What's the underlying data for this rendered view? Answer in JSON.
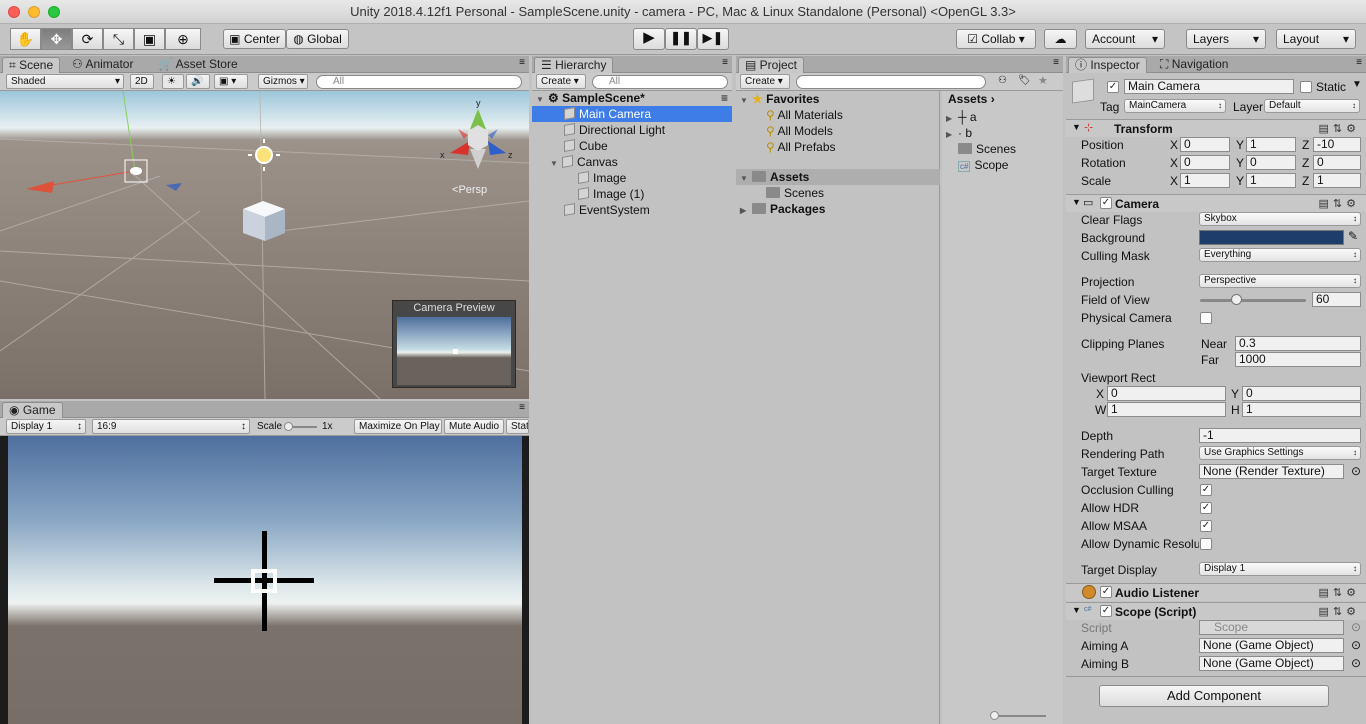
{
  "window": {
    "title": "Unity 2018.4.12f1 Personal - SampleScene.unity - camera - PC, Mac & Linux Standalone (Personal) <OpenGL 3.3>"
  },
  "toolbar": {
    "center": "Center",
    "global": "Global",
    "collab": "Collab",
    "account": "Account",
    "layers": "Layers",
    "layout": "Layout"
  },
  "scene": {
    "tabs": [
      "Scene",
      "Animator",
      "Asset Store"
    ],
    "shaded": "Shaded",
    "mode2d": "2D",
    "gizmos": "Gizmos",
    "search_placeholder": "All",
    "persp": "Persp",
    "camera_preview": "Camera Preview"
  },
  "game": {
    "tab": "Game",
    "display": "Display 1",
    "aspect": "16:9",
    "scale_label": "Scale",
    "scale_value": "1x",
    "maximize": "Maximize On Play",
    "mute": "Mute Audio",
    "stats": "Stats"
  },
  "hierarchy": {
    "tab": "Hierarchy",
    "create": "Create",
    "search_placeholder": "All",
    "scene": "SampleScene*",
    "items": [
      "Main Camera",
      "Directional Light",
      "Cube",
      "Canvas",
      "Image",
      "Image (1)",
      "EventSystem"
    ]
  },
  "project": {
    "tab": "Project",
    "create": "Create",
    "favorites": "Favorites",
    "fav_items": [
      "All Materials",
      "All Models",
      "All Prefabs"
    ],
    "assets": "Assets",
    "scenes": "Scenes",
    "packages": "Packages",
    "breadcrumb": "Assets",
    "right_items": [
      "a",
      "b",
      "Scenes",
      "Scope"
    ]
  },
  "inspector": {
    "tabs": [
      "Inspector",
      "Navigation"
    ],
    "name": "Main Camera",
    "static": "Static",
    "tag_label": "Tag",
    "tag": "MainCamera",
    "layer_label": "Layer",
    "layer": "Default",
    "transform": {
      "title": "Transform",
      "position": {
        "label": "Position",
        "x": "0",
        "y": "1",
        "z": "-10"
      },
      "rotation": {
        "label": "Rotation",
        "x": "0",
        "y": "0",
        "z": "0"
      },
      "scale": {
        "label": "Scale",
        "x": "1",
        "y": "1",
        "z": "1"
      }
    },
    "camera": {
      "title": "Camera",
      "clear_flags": "Clear Flags",
      "clear_flags_v": "Skybox",
      "background": "Background",
      "background_color": "#1f3d6b",
      "culling_mask": "Culling Mask",
      "culling_mask_v": "Everything",
      "projection": "Projection",
      "projection_v": "Perspective",
      "fov": "Field of View",
      "fov_v": "60",
      "physical": "Physical Camera",
      "clipping": "Clipping Planes",
      "near": "Near",
      "near_v": "0.3",
      "far": "Far",
      "far_v": "1000",
      "viewport": "Viewport Rect",
      "vx": "0",
      "vy": "0",
      "vw": "1",
      "vh": "1",
      "depth": "Depth",
      "depth_v": "-1",
      "rendering_path": "Rendering Path",
      "rendering_path_v": "Use Graphics Settings",
      "target_texture": "Target Texture",
      "target_texture_v": "None (Render Texture)",
      "occlusion": "Occlusion Culling",
      "hdr": "Allow HDR",
      "msaa": "Allow MSAA",
      "dynres": "Allow Dynamic Resolu",
      "target_display": "Target Display",
      "target_display_v": "Display 1"
    },
    "audio_listener": "Audio Listener",
    "scope": {
      "title": "Scope (Script)",
      "script": "Script",
      "script_v": "Scope",
      "aiming_a": "Aiming A",
      "aiming_a_v": "None (Game Object)",
      "aiming_b": "Aiming B",
      "aiming_b_v": "None (Game Object)"
    },
    "add_component": "Add Component"
  }
}
